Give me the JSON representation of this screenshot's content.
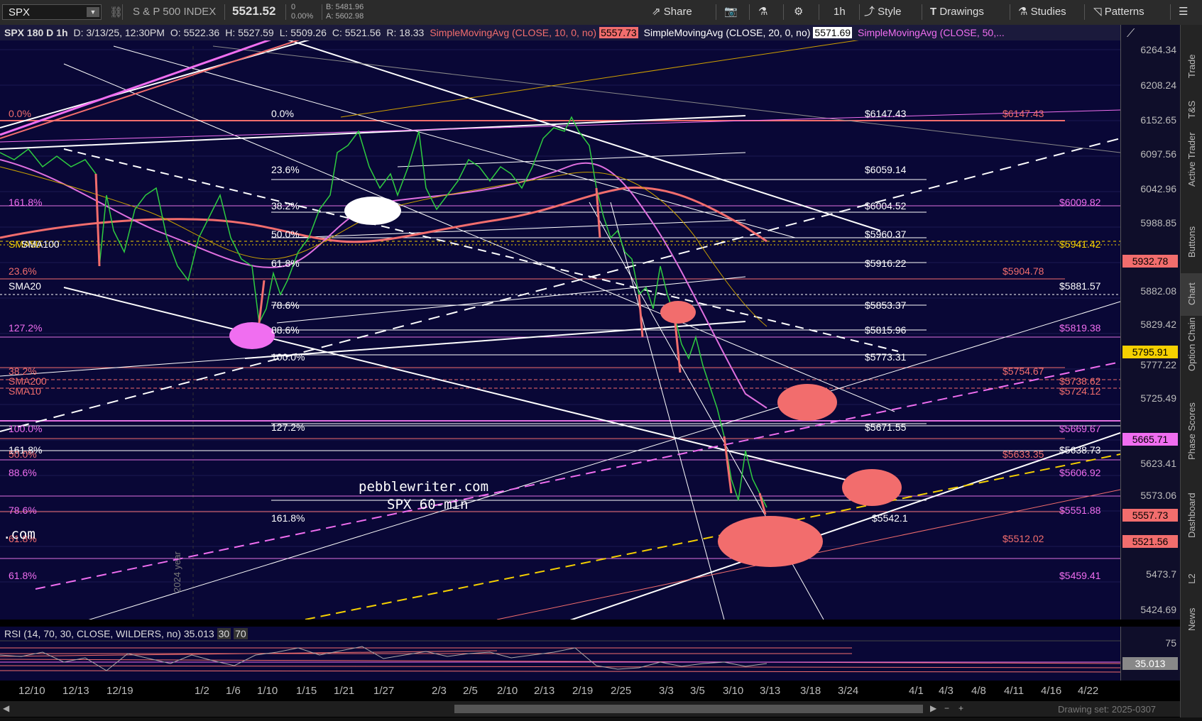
{
  "toolbar": {
    "symbol": "SPX",
    "description": "S & P 500 INDEX",
    "last": "5521.52",
    "change": "0",
    "change_pct": "0.00%",
    "bid": "B: 5481.96",
    "ask": "A: 5602.98",
    "share": "Share",
    "interval": "1h",
    "style": "Style",
    "drawings": "Drawings",
    "studies": "Studies",
    "patterns": "Patterns"
  },
  "info_bar": {
    "title": "SPX 180 D 1h",
    "date": "D: 3/13/25, 12:30PM",
    "open": "O: 5522.36",
    "high": "H: 5527.59",
    "low": "L: 5509.26",
    "close": "C: 5521.56",
    "range": "R: 18.33",
    "sma10": "SimpleMovingAvg (CLOSE, 10, 0, no)",
    "sma10_val": "5557.73",
    "sma20": "SimpleMovingAvg (CLOSE, 20, 0, no)",
    "sma20_val": "5571.69",
    "sma50": "SimpleMovingAvg (CLOSE, 50,..."
  },
  "price_ticks": [
    "6264.34",
    "6208.24",
    "6152.65",
    "6097.56",
    "6042.96",
    "5988.85",
    "5882.08",
    "5829.42",
    "5777.22",
    "5725.49",
    "5623.41",
    "5573.06",
    "5473.7",
    "5424.69"
  ],
  "price_labels": [
    {
      "text": "5932.78",
      "color": "#f26d6d"
    },
    {
      "text": "5795.91",
      "color": "#f5d000"
    },
    {
      "text": "5665.71",
      "color": "#f06ef0"
    },
    {
      "text": "5557.73",
      "color": "#f26d6d"
    },
    {
      "text": "5521.56",
      "color": "#f26d6d"
    }
  ],
  "fib_white": [
    {
      "pct": "0.0%",
      "price": "$6147.43"
    },
    {
      "pct": "23.6%",
      "price": "$6059.14"
    },
    {
      "pct": "38.2%",
      "price": "$6004.52"
    },
    {
      "pct": "50.0%",
      "price": "$5960.37"
    },
    {
      "pct": "61.8%",
      "price": "$5916.22"
    },
    {
      "pct": "78.6%",
      "price": "$5853.37"
    },
    {
      "pct": "88.6%",
      "price": "$5815.96"
    },
    {
      "pct": "100.0%",
      "price": "$5773.31"
    },
    {
      "pct": "127.2%",
      "price": "$5671.55"
    },
    {
      "pct": "161.8%",
      "price": "$5542.1"
    }
  ],
  "fib_red": [
    "$6147.43",
    "$5904.78",
    "$5754.67",
    "$5633.35",
    "$5512.02"
  ],
  "fib_magenta": [
    "$6009.82",
    "$5819.38",
    "$5669.67",
    "$5606.92",
    "$5551.88",
    "$5459.41"
  ],
  "misc_labels": [
    "$5881.57",
    "$5638.73",
    "$5941.42",
    "$5738.62",
    "$5724.12"
  ],
  "left_labels": [
    "0.0%",
    "161.8%",
    "SMA50",
    "SMA100",
    "23.6%",
    "SMA20",
    "127.2%",
    "38.2%",
    "SMA200",
    "SMA10",
    "100.0%",
    "161.8%",
    "50.0%",
    "88.6%",
    "78.6%",
    "61.8%",
    "61.8%"
  ],
  "watermark": {
    "line1": "pebblewriter.com",
    "line2": "SPX 60-min",
    "year": "2024 year",
    "com": ".com"
  },
  "rsi": {
    "label": "RSI (14, 70, 30, CLOSE, WILDERS, no)",
    "value": "35.013",
    "high": "30",
    "low": "70",
    "tick75": "75"
  },
  "time_labels": [
    "12/10",
    "12/13",
    "12/19",
    "1/2",
    "1/6",
    "1/10",
    "1/15",
    "1/21",
    "1/27",
    "2/3",
    "2/5",
    "2/10",
    "2/13",
    "2/19",
    "2/25",
    "3/3",
    "3/5",
    "3/10",
    "3/13",
    "3/18",
    "3/24",
    "4/1",
    "4/3",
    "4/8",
    "4/11",
    "4/16",
    "4/22"
  ],
  "drawing_set": "Drawing set: 2025-0307",
  "side_tabs": [
    "Trade",
    "T&S",
    "Active Trader",
    "Buttons",
    "Chart",
    "Option Chain",
    "Phase Scores",
    "Dashboard",
    "L2",
    "News"
  ],
  "colors": {
    "bg": "#090736",
    "red": "#f26d6d",
    "magenta": "#f06ef0",
    "yellow": "#f5d000",
    "white": "#ffffff"
  }
}
